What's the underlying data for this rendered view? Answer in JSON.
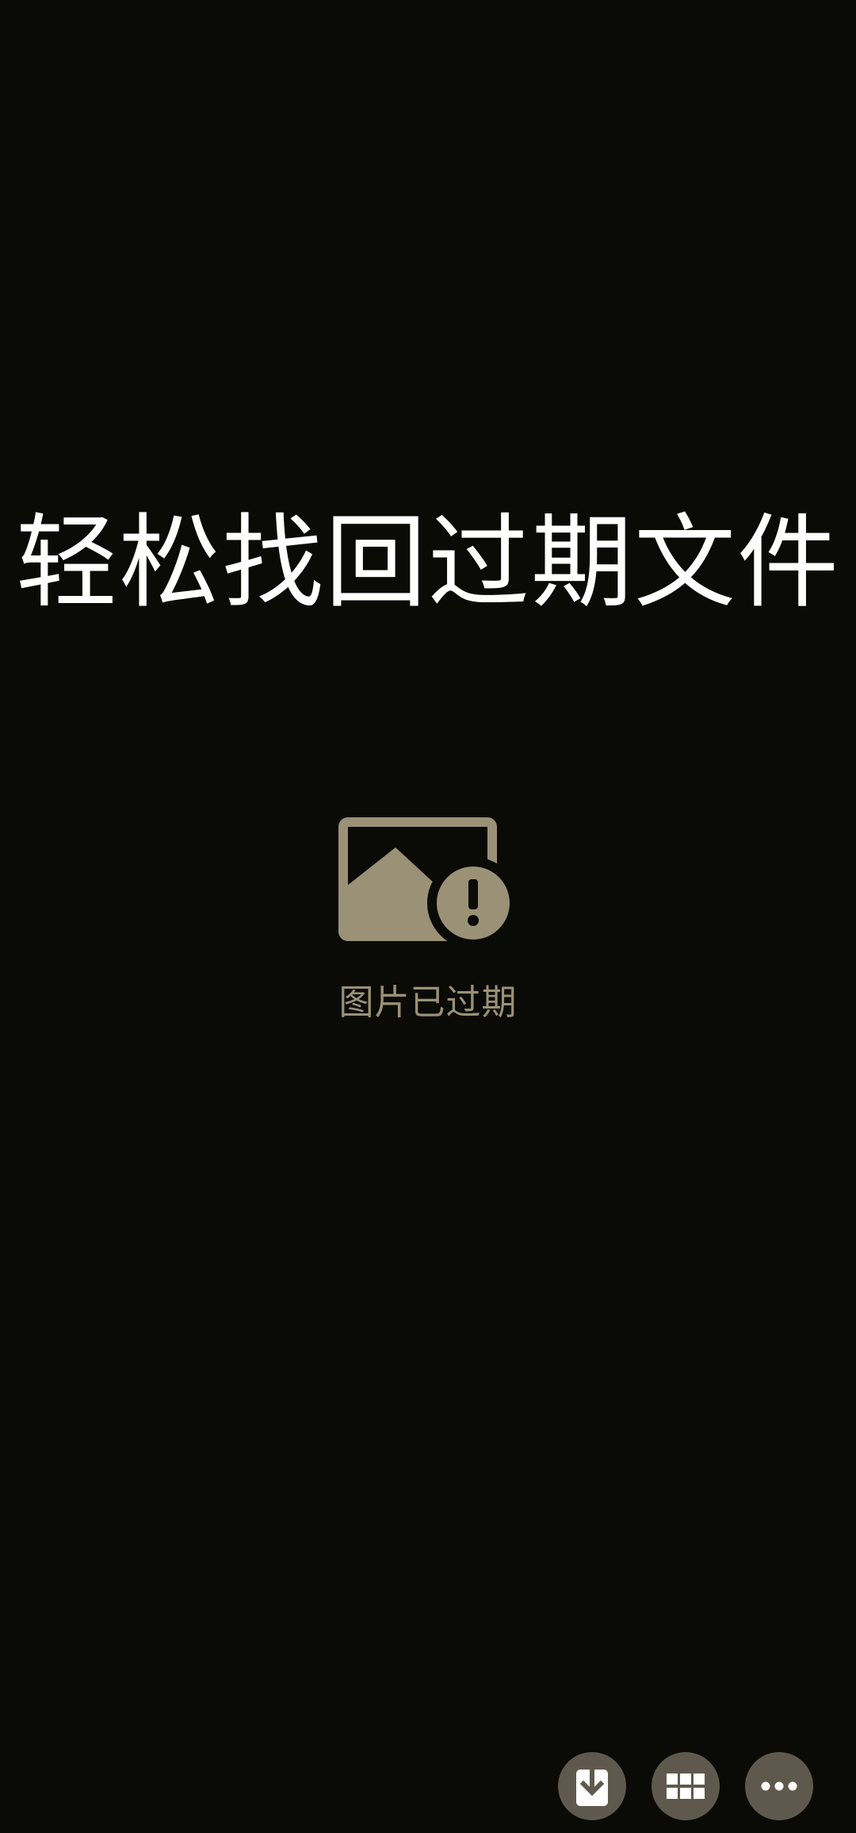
{
  "headline": "轻松找回过期文件",
  "expired": {
    "icon": "image-expired-icon",
    "text": "图片已过期",
    "color": "#9a9176"
  },
  "toolbar": {
    "buttons": [
      {
        "icon": "download-icon"
      },
      {
        "icon": "grid-icon"
      },
      {
        "icon": "more-icon"
      }
    ],
    "button_color": "#5f594d"
  },
  "colors": {
    "background": "#0a0a07",
    "headline": "#ffffff"
  }
}
